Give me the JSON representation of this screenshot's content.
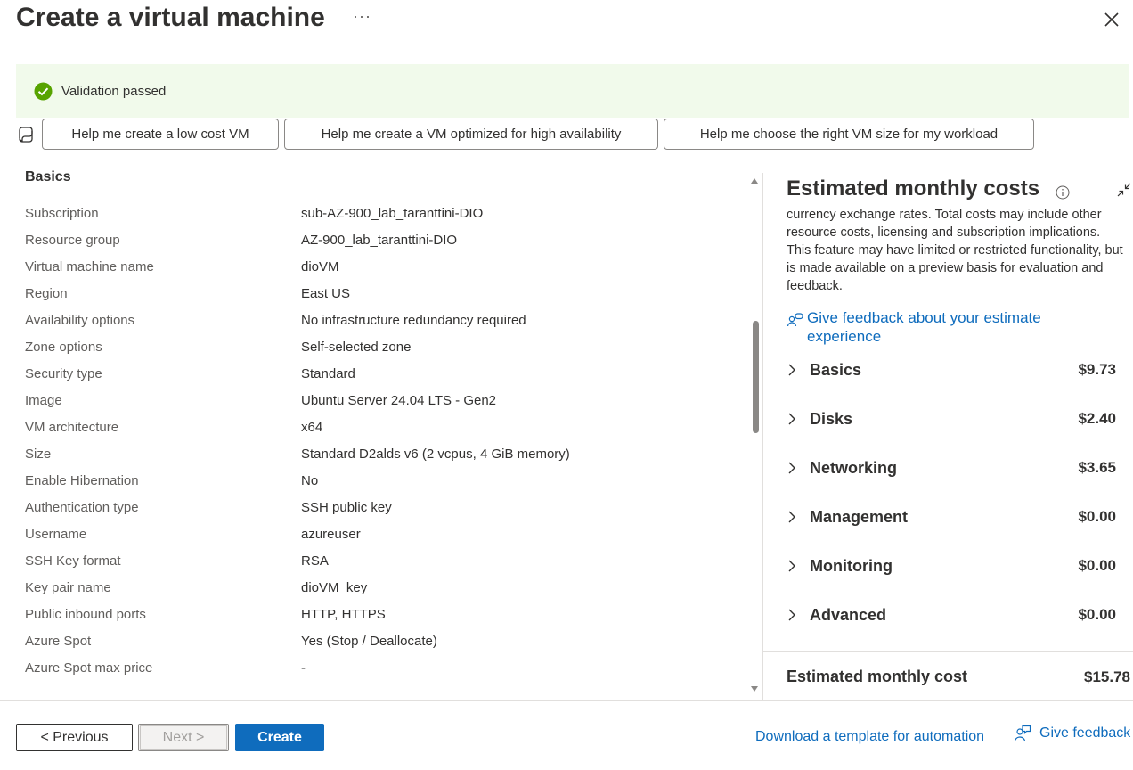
{
  "header": {
    "title": "Create a virtual machine",
    "more_label": "···"
  },
  "validation": {
    "text": "Validation passed",
    "status_color": "#57a300"
  },
  "prompts": [
    "Help me create a low cost VM",
    "Help me create a VM optimized for high availability",
    "Help me choose the right VM size for my workload"
  ],
  "summary": {
    "section_title": "Basics",
    "rows": [
      {
        "label": "Subscription",
        "value": "sub-AZ-900_lab_taranttini-DIO"
      },
      {
        "label": "Resource group",
        "value": "AZ-900_lab_taranttini-DIO"
      },
      {
        "label": "Virtual machine name",
        "value": "dioVM"
      },
      {
        "label": "Region",
        "value": "East US"
      },
      {
        "label": "Availability options",
        "value": "No infrastructure redundancy required"
      },
      {
        "label": "Zone options",
        "value": "Self-selected zone"
      },
      {
        "label": "Security type",
        "value": "Standard"
      },
      {
        "label": "Image",
        "value": "Ubuntu Server 24.04 LTS - Gen2"
      },
      {
        "label": "VM architecture",
        "value": "x64"
      },
      {
        "label": "Size",
        "value": "Standard D2alds v6 (2 vcpus, 4 GiB memory)"
      },
      {
        "label": "Enable Hibernation",
        "value": "No"
      },
      {
        "label": "Authentication type",
        "value": "SSH public key"
      },
      {
        "label": "Username",
        "value": "azureuser"
      },
      {
        "label": "SSH Key format",
        "value": "RSA"
      },
      {
        "label": "Key pair name",
        "value": "dioVM_key"
      },
      {
        "label": "Public inbound ports",
        "value": "HTTP, HTTPS"
      },
      {
        "label": "Azure Spot",
        "value": "Yes (Stop / Deallocate)"
      },
      {
        "label": "Azure Spot max price",
        "value": "-"
      }
    ]
  },
  "costs": {
    "title": "Estimated monthly costs",
    "description": "currency exchange rates. Total costs may include other resource costs, licensing and subscription implications. This feature may have limited or restricted functionality, but is made available on a preview basis for evaluation and feedback.",
    "feedback_link": "Give feedback about your estimate experience",
    "items": [
      {
        "name": "Basics",
        "price": "$9.73"
      },
      {
        "name": "Disks",
        "price": "$2.40"
      },
      {
        "name": "Networking",
        "price": "$3.65"
      },
      {
        "name": "Management",
        "price": "$0.00"
      },
      {
        "name": "Monitoring",
        "price": "$0.00"
      },
      {
        "name": "Advanced",
        "price": "$0.00"
      }
    ],
    "total_label": "Estimated monthly cost",
    "total_value": "$15.78"
  },
  "footer": {
    "previous_label": "< Previous",
    "next_label": "Next >",
    "create_label": "Create",
    "download_label": "Download a template for automation",
    "feedback_label": "Give feedback"
  },
  "colors": {
    "accent": "#0f6cbd",
    "success_bg": "#f1faeb"
  }
}
